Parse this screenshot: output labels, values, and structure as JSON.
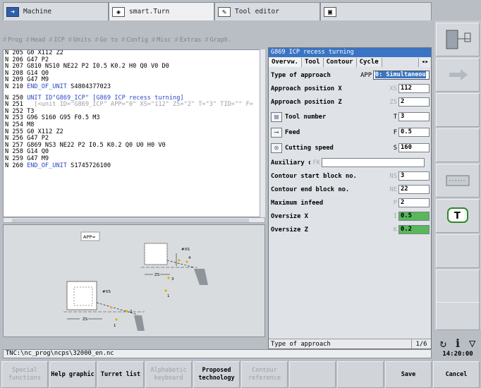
{
  "tabs": [
    {
      "label": "Machine",
      "icon": "arrow-right-icon"
    },
    {
      "label": "smart.Turn",
      "icon": "diamond-arrow-icon"
    },
    {
      "label": "Tool editor",
      "icon": "tool-edit-icon"
    },
    {
      "label": "",
      "icon": "save-disk-icon"
    }
  ],
  "menu": [
    "Prog",
    "Head",
    "ICP",
    "Units",
    "Go to",
    "Config",
    "Misc",
    "Extras",
    "Graph."
  ],
  "code": {
    "block1": [
      {
        "n": "N 205",
        "t": "G0 X112 Z2"
      },
      {
        "n": "N 206",
        "t": "G47 P2"
      },
      {
        "n": "N 207",
        "t": "G810 NS10 NE22 P2 I0.5 K0.2 H0 Q0 V0 D0"
      },
      {
        "n": "N 208",
        "t": "G14 Q0"
      },
      {
        "n": "N 209",
        "t": "G47 M9"
      },
      {
        "n": "N 210",
        "t": "END_OF_UNIT",
        "t2": " S4804377023"
      }
    ],
    "block2": [
      {
        "n": "N 250",
        "t": "UNIT",
        "t2": " ID\"G869_ICP\" [G869 ICP recess turning]"
      },
      {
        "n": "N 251",
        "t": "  [<unit ID=\"G869_ICP\" APP=\"0\" XS=\"112\" ZS=\"2\" T=\"3\" TID=\"\" F="
      },
      {
        "n": "N 252",
        "t": "T3"
      },
      {
        "n": "N 253",
        "t": "G96 S160 G95 F0.5 M3"
      },
      {
        "n": "N 254",
        "t": "M8"
      },
      {
        "n": "N 255",
        "t": "G0 X112 Z2"
      },
      {
        "n": "N 256",
        "t": "G47 P2"
      },
      {
        "n": "N 257",
        "t": "G869 NS3 NE22 P2 I0.5 K0.2 Q0 U0 H0 V0"
      },
      {
        "n": "N 258",
        "t": "G14 Q0"
      },
      {
        "n": "N 259",
        "t": "G47 M9"
      },
      {
        "n": "N 260",
        "t": "END_OF_UNIT",
        "t2": " S1745726100"
      }
    ]
  },
  "graphic": {
    "app_label": "APP=",
    "labels": [
      "#XS",
      "#XS",
      "ZS",
      "ZS",
      "1",
      "2",
      "3",
      "4",
      "1",
      "2",
      "3",
      "4"
    ]
  },
  "dialog": {
    "title": "G869 ICP recess turning",
    "tabs": [
      "Overvw.",
      "Tool",
      "Contour",
      "Cycle"
    ],
    "rows": [
      {
        "label": "Type of approach",
        "addr": "APP",
        "value": "0: Simultaneou",
        "kind": "select"
      },
      {
        "label": "Approach position X",
        "addr": "XS",
        "value": "112"
      },
      {
        "label": "Approach position Z",
        "addr": "ZS",
        "value": "2"
      },
      {
        "label": "Tool number",
        "addr": "T",
        "value": "3",
        "icon": "tool-icon"
      },
      {
        "label": "Feed",
        "addr": "F",
        "value": "0.5",
        "icon": "feed-icon"
      },
      {
        "label": "Cutting speed",
        "addr": "S",
        "value": "160",
        "icon": "cutting-speed-icon"
      },
      {
        "label": "Auxiliary c…",
        "addr": "FK",
        "value": "",
        "kind": "wide"
      },
      {
        "label": "Contour start block no.",
        "addr": "NS",
        "value": "3"
      },
      {
        "label": "Contour end block no.",
        "addr": "NE",
        "value": "22"
      },
      {
        "label": "Maximum infeed",
        "addr": "P",
        "value": "2"
      },
      {
        "label": "Oversize X",
        "addr": "I",
        "value": "0.5",
        "green": true
      },
      {
        "label": "Oversize Z",
        "addr": "K",
        "value": "0.2",
        "green": true
      }
    ],
    "status": "Type of approach",
    "page": "1/6"
  },
  "path": "TNC:\\nc_prog\\ncps\\32000_en.nc",
  "clock": "14:20:00",
  "softkeys": [
    {
      "label": "Special functions",
      "enabled": false
    },
    {
      "label": "Help graphic",
      "enabled": true
    },
    {
      "label": "Turret list",
      "enabled": true
    },
    {
      "label": "Alphabetic keyboard",
      "enabled": false
    },
    {
      "label": "Proposed technology",
      "enabled": true
    },
    {
      "label": "Contour reference",
      "enabled": false
    },
    {
      "label": "",
      "enabled": false
    },
    {
      "label": "",
      "enabled": false
    },
    {
      "label": "Save",
      "enabled": true
    },
    {
      "label": "Cancel",
      "enabled": true
    }
  ],
  "colors": {
    "accent": "#3a74c4",
    "code_blue": "#2a48c8",
    "green_field": "#58b85b"
  }
}
